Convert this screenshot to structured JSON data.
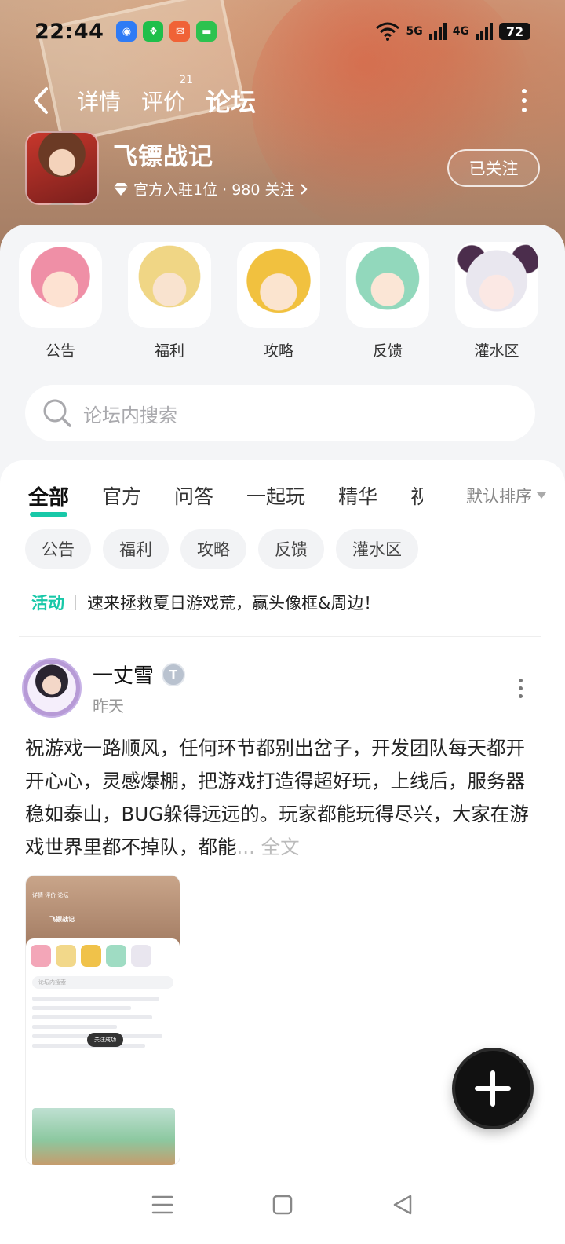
{
  "status_bar": {
    "time": "22:44",
    "battery": "72",
    "network_5g": "5G",
    "network_4g": "4G",
    "notification_icons": [
      "hotspot-icon",
      "wechat-pay-icon",
      "mail-icon",
      "message-icon"
    ]
  },
  "nav": {
    "tabs": [
      {
        "label": "详情"
      },
      {
        "label": "评价",
        "badge": "21"
      },
      {
        "label": "论坛",
        "active": true
      }
    ]
  },
  "app": {
    "name": "飞镖战记",
    "stats_text": "官方入驻1位 · 980 关注",
    "follow_label": "已关注"
  },
  "categories": [
    {
      "label": "公告",
      "color": "#f3a6b8"
    },
    {
      "label": "福利",
      "color": "#f2d88a"
    },
    {
      "label": "攻略",
      "color": "#f0c24a"
    },
    {
      "label": "反馈",
      "color": "#9fdcc3"
    },
    {
      "label": "灌水区",
      "color": "#e9e6ef"
    }
  ],
  "search": {
    "placeholder": "论坛内搜索"
  },
  "filter_tabs": [
    "全部",
    "官方",
    "问答",
    "一起玩",
    "精华",
    "视频"
  ],
  "sort_label": "默认排序",
  "chips": [
    "公告",
    "福利",
    "攻略",
    "反馈",
    "灌水区"
  ],
  "activity": {
    "tag": "活动",
    "text": "速来拯救夏日游戏荒，赢头像框&周边！"
  },
  "post": {
    "author": "一丈雪",
    "badge": "T",
    "time": "昨天",
    "body": "祝游戏一路顺风，任何环节都别出岔子，开发团队每天都开开心心，灵感爆棚，把游戏打造得超好玩，上线后，服务器稳如泰山，BUG躲得远远的。玩家都能玩得尽兴，大家在游戏世界里都不掉队，都能",
    "more_label": "... 全文",
    "thumb": {
      "tabs": "详情  评价  论坛",
      "app_name": "飞镖战记",
      "search": "论坛内搜索",
      "toast": "关注成功",
      "post_title": "飞镖战记",
      "image_caption": "飞镖战记"
    }
  },
  "colors": {
    "accent": "#18c8a8",
    "text_primary": "#222222",
    "text_secondary": "#999999",
    "chip_bg": "#f2f3f5"
  }
}
